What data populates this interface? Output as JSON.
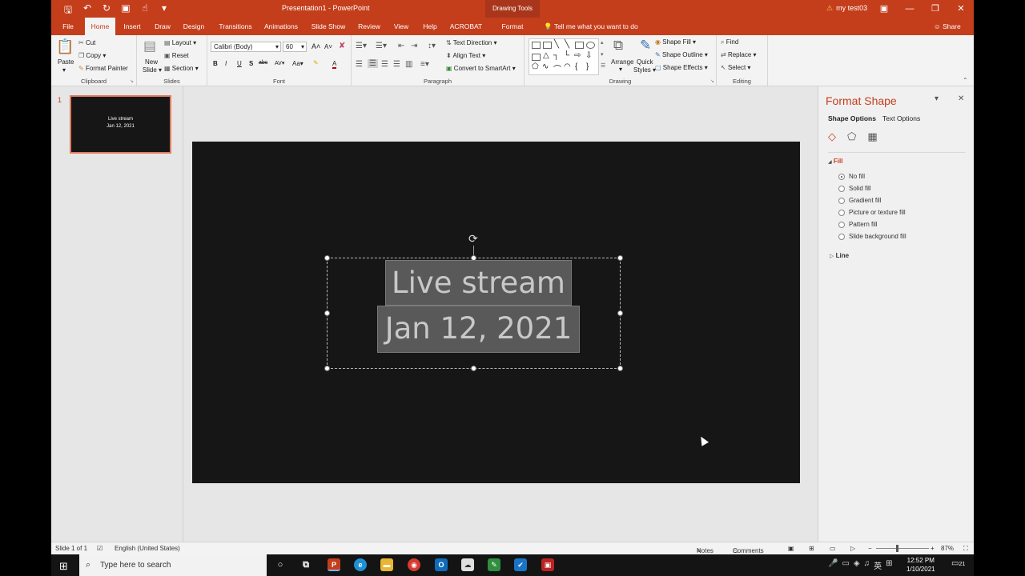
{
  "titlebar": {
    "doc_title": "Presentation1 - PowerPoint",
    "context_group": "Drawing Tools",
    "user": "my test03",
    "warn_icon": "warning-icon"
  },
  "tabs": [
    {
      "label": "File",
      "active": false
    },
    {
      "label": "Home",
      "active": true
    },
    {
      "label": "Insert",
      "active": false
    },
    {
      "label": "Draw",
      "active": false
    },
    {
      "label": "Design",
      "active": false
    },
    {
      "label": "Transitions",
      "active": false
    },
    {
      "label": "Animations",
      "active": false
    },
    {
      "label": "Slide Show",
      "active": false
    },
    {
      "label": "Review",
      "active": false
    },
    {
      "label": "View",
      "active": false
    },
    {
      "label": "Help",
      "active": false
    },
    {
      "label": "ACROBAT",
      "active": false
    },
    {
      "label": "Format",
      "active": false
    }
  ],
  "tellme": "Tell me what you want to do",
  "share": "Share",
  "ribbon": {
    "clipboard": {
      "name": "Clipboard",
      "paste": "Paste",
      "cut": "Cut",
      "copy": "Copy",
      "format_painter": "Format Painter"
    },
    "slides": {
      "name": "Slides",
      "new_slide": "New",
      "new_slide2": "Slide",
      "layout": "Layout",
      "reset": "Reset",
      "section": "Section"
    },
    "font": {
      "name": "Font",
      "family": "Calibri (Body)",
      "size": "60",
      "bold": "B",
      "italic": "I",
      "underline": "U",
      "shadow": "S",
      "strike": "abc",
      "spacing": "AV",
      "case": "Aa",
      "color": "A"
    },
    "paragraph": {
      "name": "Paragraph",
      "text_direction": "Text Direction",
      "align_text": "Align Text",
      "smartart": "Convert to SmartArt"
    },
    "drawing": {
      "name": "Drawing",
      "arrange": "Arrange",
      "quick_styles": "Quick",
      "quick_styles2": "Styles",
      "shape_fill": "Shape Fill",
      "shape_outline": "Shape Outline",
      "shape_effects": "Shape Effects"
    },
    "editing": {
      "name": "Editing",
      "find": "Find",
      "replace": "Replace",
      "select": "Select"
    }
  },
  "thumbnail": {
    "number": "1",
    "line1": "Live stream",
    "line2": "Jan 12, 2021"
  },
  "slide": {
    "line1": "Live stream",
    "line2": "Jan 12, 2021"
  },
  "format_pane": {
    "title": "Format Shape",
    "tab_shape": "Shape Options",
    "tab_text": "Text Options",
    "fill_section": "Fill",
    "fill_options": [
      {
        "label": "No fill",
        "selected": true
      },
      {
        "label": "Solid fill",
        "selected": false
      },
      {
        "label": "Gradient fill",
        "selected": false
      },
      {
        "label": "Picture or texture fill",
        "selected": false
      },
      {
        "label": "Pattern fill",
        "selected": false
      },
      {
        "label": "Slide background fill",
        "selected": false
      }
    ],
    "line_section": "Line"
  },
  "statusbar": {
    "slide_info": "Slide 1 of 1",
    "language": "English (United States)",
    "notes": "Notes",
    "comments": "Comments",
    "zoom": "87%"
  },
  "taskbar": {
    "search_placeholder": "Type here to search",
    "time": "12:52 PM",
    "date": "1/10/2021",
    "ime": "英",
    "notifications": "21"
  },
  "colors": {
    "accent": "#c43e1c",
    "slide_bg": "#161616"
  }
}
